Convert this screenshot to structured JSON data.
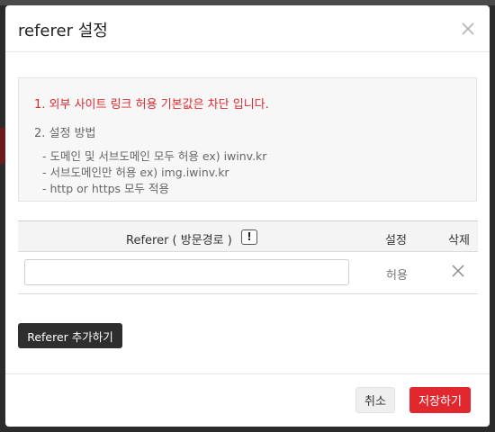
{
  "modal": {
    "title": "referer 설정",
    "close_icon": "close-icon"
  },
  "info": {
    "line1": "1. 외부 사이트 링크 허용 기본값은 차단 입니다.",
    "line2": "2. 설정 방법",
    "subitems": [
      "- 도메인 및 서브도메인 모두 허용 ex) iwinv.kr",
      "- 서브도메인만 허용 ex) img.iwinv.kr",
      "- http or https 모두 적용"
    ],
    "accent_color": "#e0282e"
  },
  "table": {
    "headers": {
      "referer": "Referer ( 방문경로 )",
      "help": "!",
      "setting": "설정",
      "delete": "삭제"
    },
    "rows": [
      {
        "referer_value": "",
        "setting": "허용",
        "delete_icon": "close-icon"
      }
    ]
  },
  "actions": {
    "add_label": "Referer 추가하기",
    "cancel_label": "취소",
    "save_label": "저장하기",
    "save_color": "#e0282e"
  }
}
